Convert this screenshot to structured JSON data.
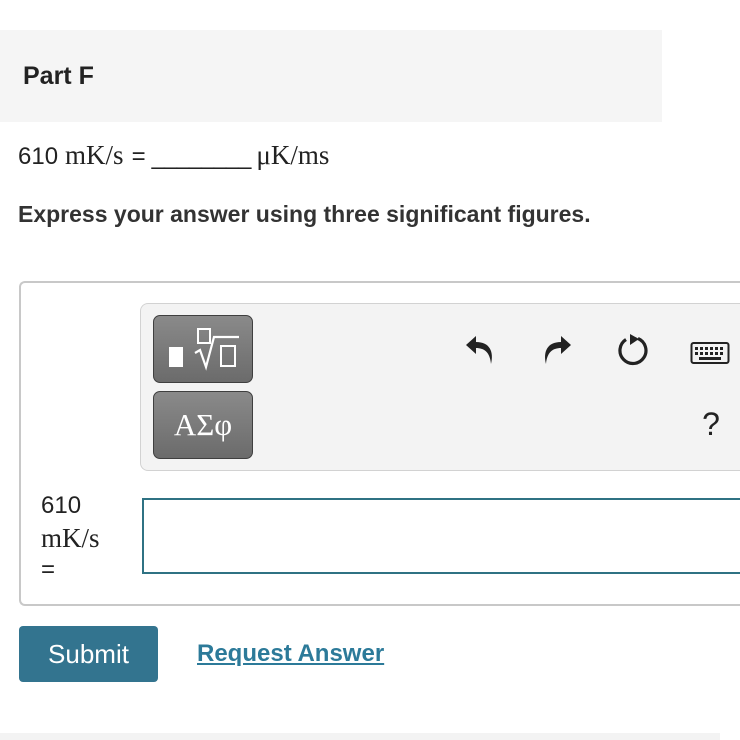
{
  "part": {
    "title": "Part F"
  },
  "question": {
    "value": "610",
    "unit": "mK/s",
    "equals": "=",
    "blank": "________",
    "target_unit": "μK/ms"
  },
  "instructions": "Express your answer using three significant figures.",
  "toolbar": {
    "templates_icon": "templates-sqrt-icon",
    "symbols_label": "ΑΣφ",
    "undo_icon": "undo-icon",
    "redo_icon": "redo-icon",
    "reset_icon": "reset-icon",
    "keyboard_icon": "keyboard-icon",
    "help_label": "?"
  },
  "answer": {
    "label_value": "610",
    "label_unit": "mK/s",
    "label_equals": "=",
    "input_value": "",
    "input_placeholder": ""
  },
  "actions": {
    "submit_label": "Submit",
    "request_answer_label": "Request Answer"
  },
  "colors": {
    "primary": "#33748f",
    "link": "#2c7a99",
    "input_border": "#2f7283",
    "tool_button": "#6b6b6b"
  }
}
